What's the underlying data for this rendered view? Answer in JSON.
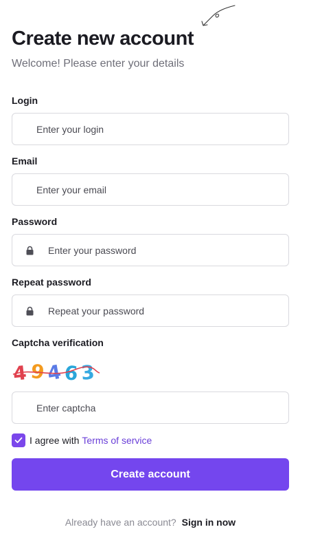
{
  "header": {
    "title": "Create new account",
    "subtitle": "Welcome! Please enter your details"
  },
  "form": {
    "login": {
      "label": "Login",
      "placeholder": "Enter your login"
    },
    "email": {
      "label": "Email",
      "placeholder": "Enter your email"
    },
    "password": {
      "label": "Password",
      "placeholder": "Enter your password",
      "icon": "lock-icon"
    },
    "repeat_password": {
      "label": "Repeat password",
      "placeholder": "Repeat your password",
      "icon": "lock-icon"
    },
    "captcha": {
      "label": "Captcha verification",
      "code": "49463",
      "placeholder": "Enter captcha"
    },
    "agree": {
      "checked": true,
      "text": "I agree with",
      "link": "Terms of service"
    },
    "submit_label": "Create account"
  },
  "footer": {
    "prompt": "Already have an account?",
    "link": "Sign in now"
  },
  "colors": {
    "accent": "#7446ee",
    "link": "#6a3fd8"
  }
}
